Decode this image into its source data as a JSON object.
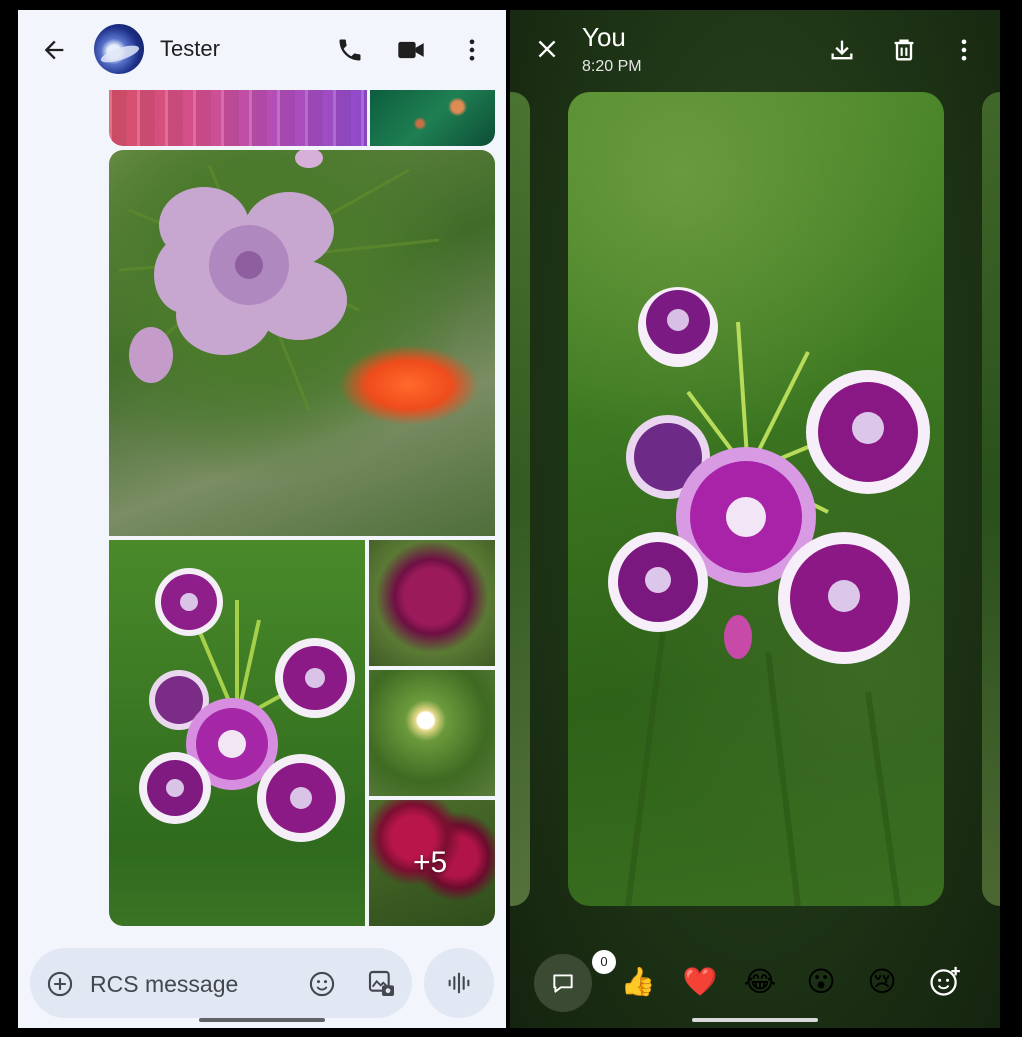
{
  "left": {
    "header": {
      "contact_name": "Tester",
      "icons": [
        "back-arrow-icon",
        "phone-icon",
        "video-camera-icon",
        "more-vert-icon"
      ]
    },
    "thread": {
      "extra_photos_label": "+5"
    },
    "composer": {
      "placeholder": "RCS message",
      "icons": [
        "add-icon",
        "emoji-icon",
        "gallery-icon",
        "voice-waveform-icon"
      ]
    }
  },
  "right": {
    "header": {
      "sender": "You",
      "time": "8:20 PM",
      "icons": [
        "close-icon",
        "download-icon",
        "delete-icon",
        "more-vert-icon"
      ]
    },
    "reactions": {
      "count": "0",
      "emojis": [
        "👍",
        "❤️",
        "😂",
        "😮",
        "😢"
      ],
      "icons": [
        "add-reaction-icon"
      ]
    }
  },
  "colors": {
    "left_bg": "#f2f5fb",
    "composer_bg": "#e1e7f3",
    "viewer_bg": "#1e3416"
  }
}
